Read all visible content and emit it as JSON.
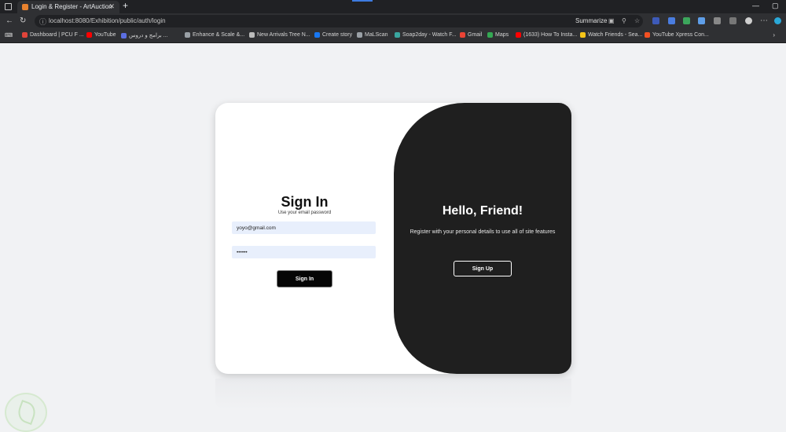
{
  "browser": {
    "tab_title": "Login & Register - ArtAuction",
    "tab_close": "✕",
    "new_tab": "+",
    "address": "localhost:8080/Exhibition/public/auth/login",
    "summarize_label": "Summarize",
    "window_controls": [
      "—",
      "▢"
    ]
  },
  "bookmarks": [
    {
      "label": "Dashboard | PCU F ...",
      "color": "#e0443a"
    },
    {
      "label": "YouTube",
      "color": "#ff0000"
    },
    {
      "label": "برامج و دروس ...",
      "color": "#5b6ee1"
    },
    {
      "label": "Enhance & Scale &...",
      "color": "#9aa0a6"
    },
    {
      "label": "New Arrivals Tree N...",
      "color": "#bbbbbb"
    },
    {
      "label": "Create story",
      "color": "#1877f2"
    },
    {
      "label": "MaLScan",
      "color": "#9aa0a6"
    },
    {
      "label": "Soap2day - Watch F...",
      "color": "#3aa6a0"
    },
    {
      "label": "Gmail",
      "color": "#ea4335"
    },
    {
      "label": "Maps",
      "color": "#34a853"
    },
    {
      "label": "(1633) How To Insta...",
      "color": "#ff0000"
    },
    {
      "label": "Watch Friends - Sea...",
      "color": "#f5c518"
    },
    {
      "label": "YouTube Xpress Con...",
      "color": "#f25022"
    }
  ],
  "signin": {
    "title": "Sign In",
    "subtitle": "Use your email password",
    "email_value": "yoyo@gmail.com",
    "password_value": "••••••",
    "button_label": "Sign In"
  },
  "panel": {
    "title": "Hello, Friend!",
    "description": "Register with your personal details to use all of site features",
    "button_label": "Sign Up"
  },
  "colors": {
    "panel_bg": "#1f1f1f",
    "input_bg": "#e8effc",
    "page_bg": "#f1f2f4"
  }
}
